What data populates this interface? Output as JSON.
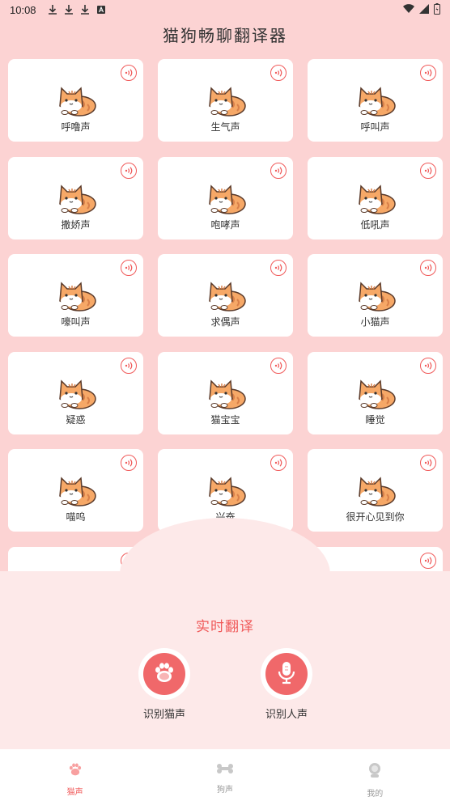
{
  "status": {
    "time": "10:08"
  },
  "app": {
    "title": "猫狗畅聊翻译器"
  },
  "cards": [
    {
      "label": "呼噜声"
    },
    {
      "label": "生气声"
    },
    {
      "label": "呼叫声"
    },
    {
      "label": "撒娇声"
    },
    {
      "label": "咆哮声"
    },
    {
      "label": "低吼声"
    },
    {
      "label": "嚎叫声"
    },
    {
      "label": "求偶声"
    },
    {
      "label": "小猫声"
    },
    {
      "label": "疑惑"
    },
    {
      "label": "猫宝宝"
    },
    {
      "label": "睡觉"
    },
    {
      "label": "喵呜"
    },
    {
      "label": "兴奋"
    },
    {
      "label": "很开心见到你"
    },
    {
      "label": ""
    },
    {
      "label": ""
    },
    {
      "label": ""
    }
  ],
  "panel": {
    "title": "实时翻译",
    "cat_button": "识别猫声",
    "human_button": "识别人声"
  },
  "tabs": [
    {
      "label": "猫声",
      "icon": "paw-icon",
      "active": true
    },
    {
      "label": "狗声",
      "icon": "bone-icon",
      "active": false
    },
    {
      "label": "我的",
      "icon": "profile-icon",
      "active": false
    }
  ],
  "colors": {
    "accent": "#f05a5a",
    "background": "#fcd3d3",
    "panel": "#fde9e9"
  }
}
